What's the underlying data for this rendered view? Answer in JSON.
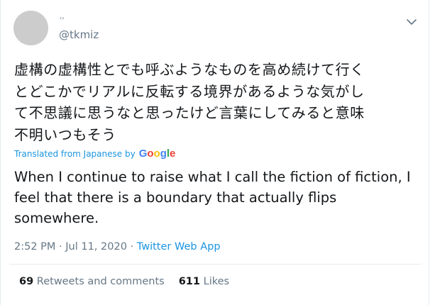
{
  "author": {
    "display_name": "‹›",
    "handle": "@tkmiz"
  },
  "tweet": {
    "text": "虚構の虚構性とでも呼ぶようなものを高め続けて行く\nとどこかでリアルに反転する境界があるような気がし\nて不思議に思うなと思ったけど言葉にしてみると意味\n不明いつもそう"
  },
  "translation": {
    "label": "Translated from Japanese by",
    "provider": "Google",
    "text": "When I continue to raise what I call the fiction of fiction, I feel that there is a boundary that actually flips somewhere."
  },
  "meta": {
    "timestamp": "2:52 PM · Jul 11, 2020 ·",
    "via": "Twitter Web App"
  },
  "stats": {
    "retweets_count": "69",
    "retweets_label": "Retweets and comments",
    "likes_count": "611",
    "likes_label": "Likes"
  },
  "icons": {
    "more": "chevron-down-icon",
    "avatar": "avatar"
  }
}
